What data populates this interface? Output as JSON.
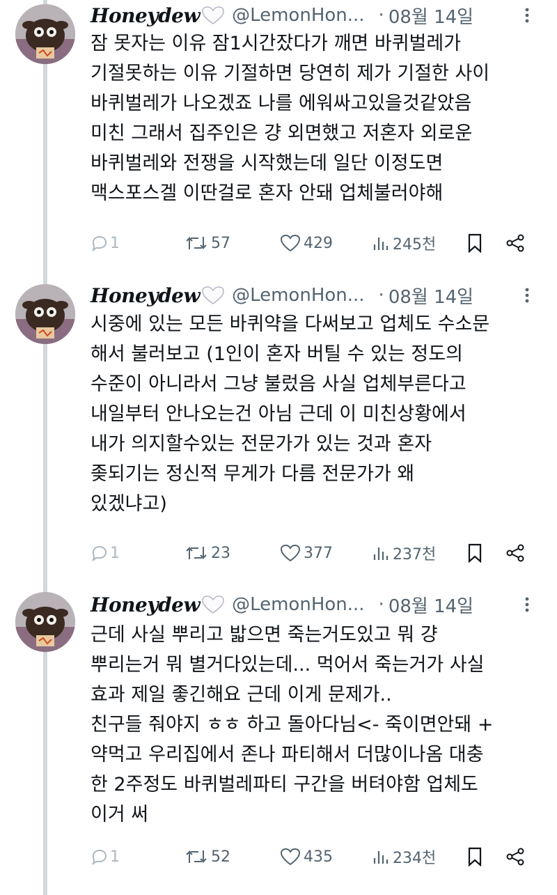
{
  "tweets": [
    {
      "author": {
        "display_name": "Honeydew",
        "badge_icon": "white-heart-icon",
        "handle": "@LemonHon...",
        "date": "08월 14일"
      },
      "text_lines": [
        "잠 못자는 이유 잠1시간잤다가 깨면 바퀴벌레가",
        "기절못하는 이유 기절하면 당연히 제가 기절한 사이",
        "바퀴벌레가 나오겠죠 나를 에워싸고있을것같았음",
        "미친 그래서 집주인은 걍 외면했고 저혼자 외로운",
        "바퀴벌레와 전쟁을 시작했는데 일단 이정도면",
        "맥스포스겔 이딴걸로 혼자 안돼 업체불러야해"
      ],
      "stats": {
        "replies": "1",
        "retweets": "57",
        "likes": "429",
        "views": "245천"
      }
    },
    {
      "author": {
        "display_name": "Honeydew",
        "badge_icon": "white-heart-icon",
        "handle": "@LemonHon...",
        "date": "08월 14일"
      },
      "text_lines": [
        "시중에 있는 모든 바퀴약을 다써보고 업체도 수소문",
        "해서 불러보고 (1인이 혼자 버틸 수 있는 정도의",
        "수준이 아니라서 그냥 불렀음 사실 업체부른다고",
        "내일부터 안나오는건 아님 근데 이 미친상황에서",
        "내가 의지할수있는 전문가가 있는 것과 혼자",
        "좆되기는 정신적 무게가 다름 전문가가 왜",
        "있겠냐고)"
      ],
      "stats": {
        "replies": "1",
        "retweets": "23",
        "likes": "377",
        "views": "237천"
      }
    },
    {
      "author": {
        "display_name": "Honeydew",
        "badge_icon": "white-heart-icon",
        "handle": "@LemonHon...",
        "date": "08월 14일"
      },
      "text_lines": [
        "근데 사실 뿌리고 밟으면 죽는거도있고 뭐 걍",
        "뿌리는거 뭐 별거다있는데... 먹어서 죽는거가 사실",
        "효과 제일 좋긴해요 근데 이게 문제가..",
        "친구들 줘야지 ㅎㅎ 하고 돌아다님<- 죽이면안돼 +",
        "약먹고 우리집에서 존나 파티해서 더많이나옴 대충",
        "한 2주정도 바퀴벌레파티 구간을 버텨야함 업체도",
        "이거 써"
      ],
      "stats": {
        "replies": "1",
        "retweets": "52",
        "likes": "435",
        "views": "234천"
      }
    }
  ],
  "ui": {
    "separator": "·",
    "icons": [
      "reply-icon",
      "retweet-icon",
      "like-icon",
      "views-icon",
      "bookmark-icon",
      "share-icon",
      "more-icon",
      "avatar-image"
    ],
    "colors": {
      "text": "#0f1419",
      "muted": "#536471",
      "thread_line": "#cfd9de"
    }
  }
}
